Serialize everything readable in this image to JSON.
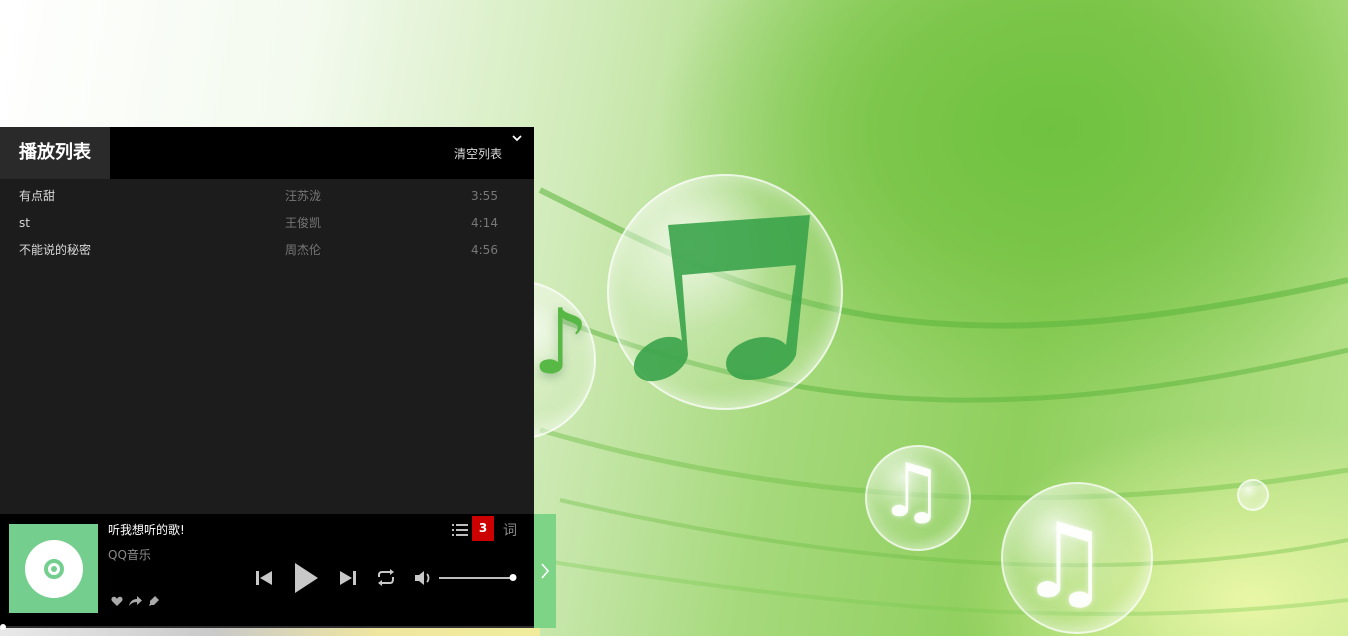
{
  "colors": {
    "accent_green": "#74cf8f",
    "badge_red": "#cc0000",
    "panel_bg": "#1c1c1c",
    "bar_bg": "#000000"
  },
  "playlist": {
    "title": "播放列表",
    "clear_label": "清空列表",
    "collapse_icon": "chevron-down-icon",
    "songs": [
      {
        "title": "有点甜",
        "artist": "汪苏泷",
        "duration": "3:55"
      },
      {
        "title": "st",
        "artist": "王俊凯",
        "duration": "4:14"
      },
      {
        "title": "不能说的秘密",
        "artist": "周杰伦",
        "duration": "4:56"
      }
    ]
  },
  "player": {
    "now_playing_title": "听我想听的歌!",
    "now_playing_artist": "QQ音乐",
    "playlist_count": "3",
    "lyric_label": "词",
    "volume_fraction": 1.0,
    "icons": [
      "heart-icon",
      "share-icon",
      "download-icon",
      "prev-icon",
      "play-icon",
      "next-icon",
      "loop-icon",
      "volume-icon",
      "playlist-icon",
      "chevron-right-icon"
    ]
  }
}
